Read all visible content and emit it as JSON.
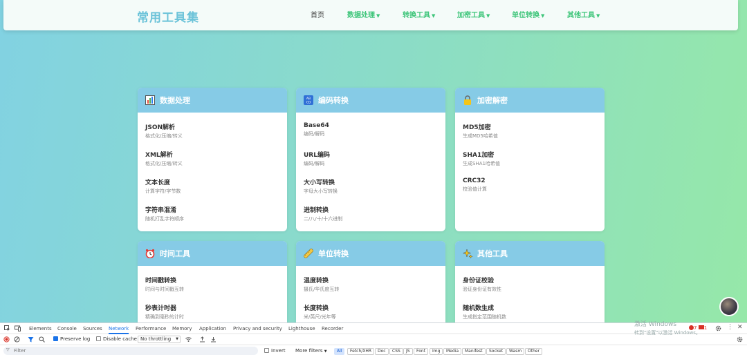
{
  "header": {
    "logo": "常用工具集",
    "home": "首页",
    "menus": [
      "数据处理",
      "转换工具",
      "加密工具",
      "单位转换",
      "其他工具"
    ],
    "caret": "▼"
  },
  "cards": [
    {
      "title": "数据处理",
      "icon": "bar-chart-icon",
      "tools": [
        {
          "name": "JSON解析",
          "desc": "格式化/压缩/转义"
        },
        {
          "name": "XML解析",
          "desc": "格式化/压缩/转义"
        },
        {
          "name": "文本长度",
          "desc": "计算字符/字节数"
        },
        {
          "name": "字符串混淆",
          "desc": "随机打乱字符顺序"
        }
      ]
    },
    {
      "title": "编码转换",
      "icon": "abcd-icon",
      "tools": [
        {
          "name": "Base64",
          "desc": "编码/解码"
        },
        {
          "name": "URL编码",
          "desc": "编码/解码"
        },
        {
          "name": "大小写转换",
          "desc": "字母大小写转换"
        },
        {
          "name": "进制转换",
          "desc": "二/八/十/十六进制"
        }
      ]
    },
    {
      "title": "加密解密",
      "icon": "lock-icon",
      "tools": [
        {
          "name": "MD5加密",
          "desc": "生成MD5哈希值"
        },
        {
          "name": "SHA1加密",
          "desc": "生成SHA1哈希值"
        },
        {
          "name": "CRC32",
          "desc": "校验值计算"
        }
      ]
    },
    {
      "title": "时间工具",
      "icon": "alarm-clock-icon",
      "tools": [
        {
          "name": "时间戳转换",
          "desc": "时间与时间戳互转"
        },
        {
          "name": "秒表计时器",
          "desc": "精确到毫秒的计时"
        }
      ]
    },
    {
      "title": "单位转换",
      "icon": "ruler-icon",
      "tools": [
        {
          "name": "温度转换",
          "desc": "摄氏/华氏度互转"
        },
        {
          "name": "长度转换",
          "desc": "米/英尺/光年等"
        }
      ]
    },
    {
      "title": "其他工具",
      "icon": "sparkles-icon",
      "tools": [
        {
          "name": "身份证校验",
          "desc": "验证身份证有效性"
        },
        {
          "name": "随机数生成",
          "desc": "生成指定范围随机数"
        }
      ]
    }
  ],
  "devtools": {
    "tabs": [
      "Elements",
      "Console",
      "Sources",
      "Network",
      "Performance",
      "Memory",
      "Application",
      "Privacy and security",
      "Lighthouse",
      "Recorder"
    ],
    "active_tab": "Network",
    "preserve_log": "Preserve log",
    "disable_cache": "Disable cache",
    "throttling": "No throttling",
    "filter_placeholder": "Filter",
    "invert": "Invert",
    "more_filters": "More filters",
    "types": [
      "All",
      "Fetch/XHR",
      "Doc",
      "CSS",
      "JS",
      "Font",
      "Img",
      "Media",
      "Manifest",
      "Socket",
      "Wasm",
      "Other"
    ],
    "error_count": "7",
    "warning_count": "1"
  },
  "watermark": {
    "line1": "激活 Windows",
    "line2": "转到\"设置\"以激活 Windows。"
  }
}
